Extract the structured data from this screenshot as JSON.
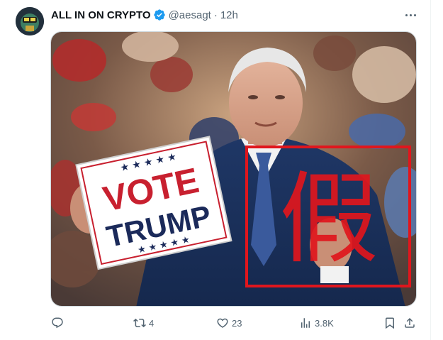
{
  "tweet": {
    "display_name": "ALL IN ON CRYPTO",
    "handle": "@aesagt",
    "separator": "·",
    "time": "12h",
    "verified_icon": "verified-badge-icon",
    "more_icon": "more-icon"
  },
  "media": {
    "sign_line1": "VOTE",
    "sign_line2": "TRUMP",
    "stamp_char": "假",
    "stamp_color": "#e0161d"
  },
  "actions": {
    "reply": {
      "icon": "reply-icon",
      "count": ""
    },
    "retweet": {
      "icon": "retweet-icon",
      "count": "4"
    },
    "like": {
      "icon": "heart-icon",
      "count": "23"
    },
    "views": {
      "icon": "views-icon",
      "count": "3.8K"
    },
    "bookmark": {
      "icon": "bookmark-icon"
    },
    "share": {
      "icon": "share-icon"
    }
  },
  "colors": {
    "accent": "#1d9bf0",
    "muted": "#536471",
    "text": "#0f1419"
  }
}
